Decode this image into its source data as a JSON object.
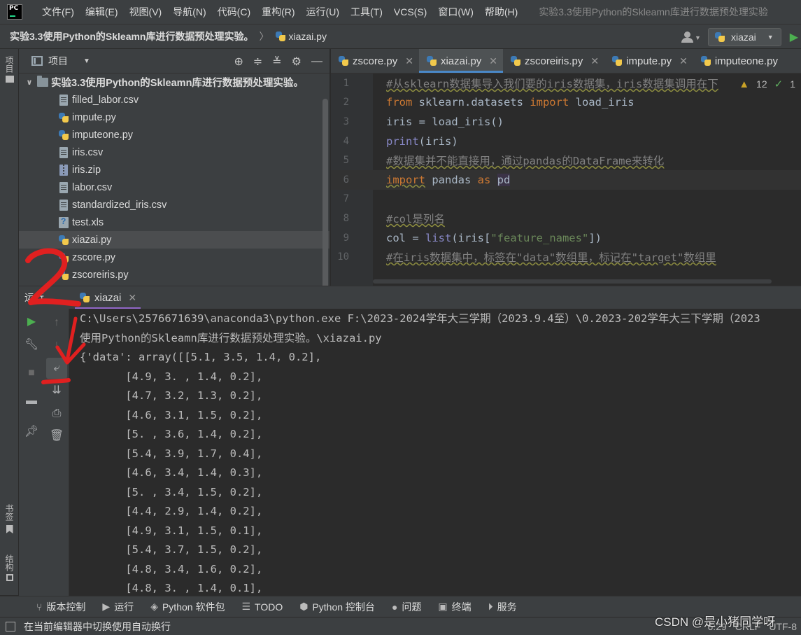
{
  "menubar": {
    "items": [
      "文件(F)",
      "编辑(E)",
      "视图(V)",
      "导航(N)",
      "代码(C)",
      "重构(R)",
      "运行(U)",
      "工具(T)",
      "VCS(S)",
      "窗口(W)",
      "帮助(H)"
    ],
    "window_title": "实验3.3使用Python的Skleamn库进行数据预处理实验"
  },
  "navbar": {
    "project": "实验3.3使用Python的Skleamn库进行数据预处理实验。",
    "file": "xiazai.py",
    "run_config": "xiazai"
  },
  "left_strip": {
    "project_tab": "项目",
    "bookmarks_tab": "书签",
    "structure_tab": "结构"
  },
  "project_panel": {
    "title": "项目",
    "root": "实验3.3使用Python的Skleamn库进行数据预处理实验。",
    "files": [
      {
        "name": "filled_labor.csv",
        "icon": "file-icon"
      },
      {
        "name": "impute.py",
        "icon": "py-icon"
      },
      {
        "name": "imputeone.py",
        "icon": "py-icon"
      },
      {
        "name": "iris.csv",
        "icon": "file-icon"
      },
      {
        "name": "iris.zip",
        "icon": "zip-icon"
      },
      {
        "name": "labor.csv",
        "icon": "file-icon"
      },
      {
        "name": "standardized_iris.csv",
        "icon": "file-icon"
      },
      {
        "name": "test.xls",
        "icon": "xls-icon"
      },
      {
        "name": "xiazai.py",
        "icon": "py-icon",
        "selected": true
      },
      {
        "name": "zscore.py",
        "icon": "py-icon"
      },
      {
        "name": "zscoreiris.py",
        "icon": "py-icon"
      }
    ]
  },
  "editor": {
    "tabs": [
      {
        "label": "zscore.py",
        "active": false
      },
      {
        "label": "xiazai.py",
        "active": true
      },
      {
        "label": "zscoreiris.py",
        "active": false
      },
      {
        "label": "impute.py",
        "active": false
      },
      {
        "label": "imputeone.py",
        "active": false
      }
    ],
    "warnings": "12",
    "checks": "1",
    "lines": [
      {
        "n": "1",
        "html": "<span class=\"tok-comment underline\">#从sklearn数据集导入我们要的iris数据集，iris数据集调用在下</span>"
      },
      {
        "n": "2",
        "html": "<span class=\"tok-kw\">from</span> sklearn.datasets <span class=\"tok-kw\">import</span> load_iris"
      },
      {
        "n": "3",
        "html": "iris = load_iris()"
      },
      {
        "n": "4",
        "html": "<span class=\"tok-builtin\">print</span>(iris)"
      },
      {
        "n": "5",
        "html": "<span class=\"tok-comment underline\">#数据集并不能直接用，通过pandas的DataFrame来转化</span>"
      },
      {
        "n": "6",
        "html": "<span class=\"tok-kw underline\">import</span> pandas <span class=\"tok-kw\">as</span> <span class=\"tok-pd\">pd</span>"
      },
      {
        "n": "7",
        "html": ""
      },
      {
        "n": "8",
        "html": "<span class=\"tok-comment underline\">#col是列名</span>"
      },
      {
        "n": "9",
        "html": "col = <span class=\"tok-builtin\">list</span>(iris[<span class=\"tok-str\">\"feature_names\"</span>])"
      },
      {
        "n": "10",
        "html": "<span class=\"tok-comment underline\">#在iris数据集中，标签在\"data\"数组里，标记在\"target\"数组里</span>"
      }
    ]
  },
  "run_panel": {
    "label": "运行",
    "tab": "xiazai",
    "output": [
      "C:\\Users\\2576671639\\anaconda3\\python.exe F:\\2023-2024学年大三学期（2023.9.4至）\\0.2023-202学年大三下学期（2023",
      "使用Python的Skleamn库进行数据预处理实验。\\xiazai.py",
      "{'data': array([[5.1, 3.5, 1.4, 0.2],",
      "       [4.9, 3. , 1.4, 0.2],",
      "       [4.7, 3.2, 1.3, 0.2],",
      "       [4.6, 3.1, 1.5, 0.2],",
      "       [5. , 3.6, 1.4, 0.2],",
      "       [5.4, 3.9, 1.7, 0.4],",
      "       [4.6, 3.4, 1.4, 0.3],",
      "       [5. , 3.4, 1.5, 0.2],",
      "       [4.4, 2.9, 1.4, 0.2],",
      "       [4.9, 3.1, 1.5, 0.1],",
      "       [5.4, 3.7, 1.5, 0.2],",
      "       [4.8, 3.4, 1.6, 0.2],",
      "       [4.8, 3. , 1.4, 0.1],"
    ],
    "left_tools": [
      "run-icon",
      "wrench-icon",
      "stop-icon",
      "layout-icon",
      "pin-icon"
    ],
    "mid_tools": [
      "up-arrow-icon",
      "down-arrow-icon",
      "soft-wrap-icon",
      "scroll-to-end-icon",
      "print-icon",
      "trash-icon"
    ]
  },
  "bottom_bar": {
    "tabs": [
      {
        "label": "版本控制",
        "icon": "vcs-icon"
      },
      {
        "label": "运行",
        "icon": "run-icon"
      },
      {
        "label": "Python 软件包",
        "icon": "packages-icon"
      },
      {
        "label": "TODO",
        "icon": "todo-icon"
      },
      {
        "label": "Python 控制台",
        "icon": "python-console-icon"
      },
      {
        "label": "问题",
        "icon": "problems-icon"
      },
      {
        "label": "终端",
        "icon": "terminal-icon"
      },
      {
        "label": "服务",
        "icon": "services-icon"
      }
    ]
  },
  "status_bar": {
    "message": "在当前编辑器中切换使用自动换行",
    "position": "6:29",
    "line_sep": "CRLF",
    "encoding": "UTF-8"
  },
  "watermark": "CSDN @是小猪同学呀",
  "annotation": {
    "label": "2",
    "color": "#e02020"
  }
}
